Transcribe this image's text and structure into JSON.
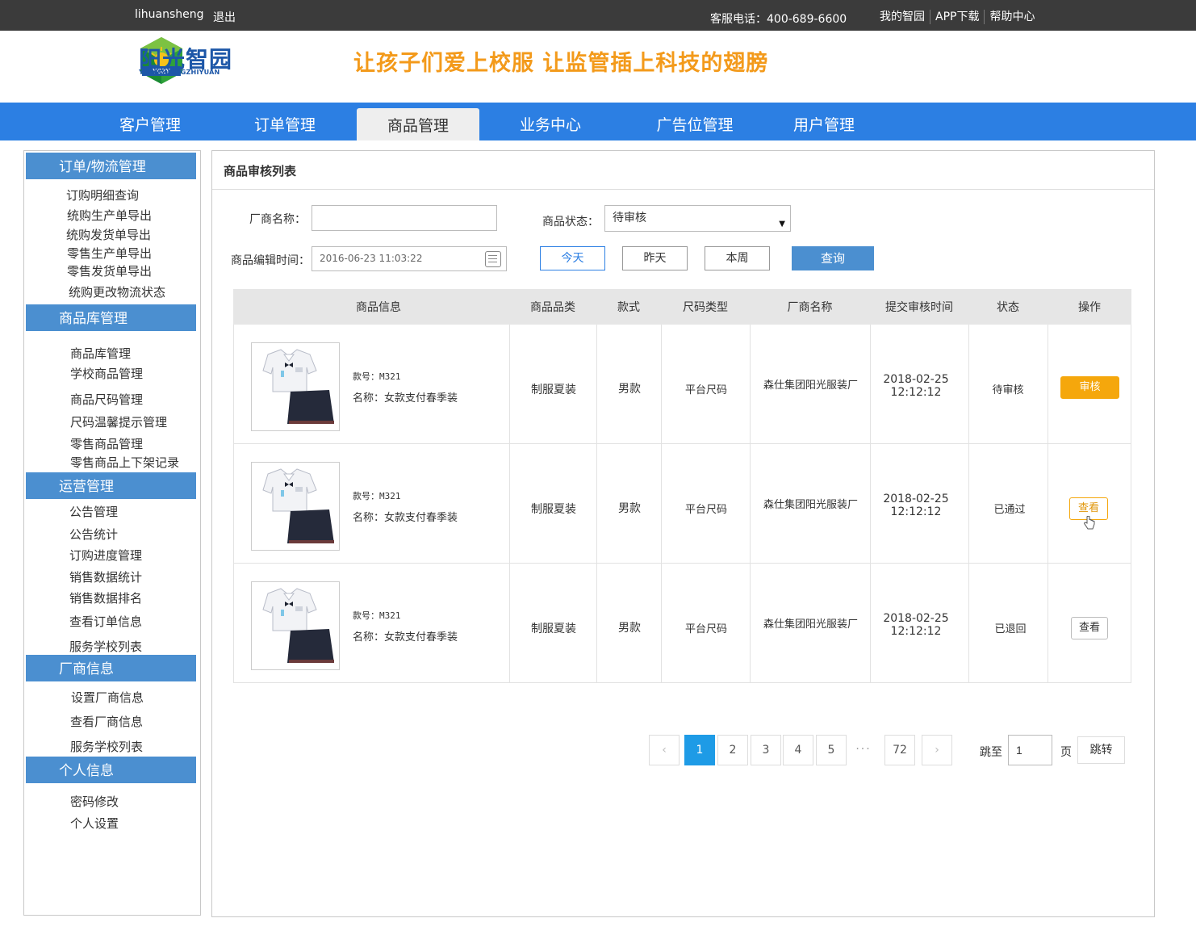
{
  "topbar": {
    "username": "lihuansheng",
    "logout": "退出",
    "hotline": "客服电话：400-689-6600",
    "links": [
      "我的智园",
      "APP下载",
      "帮助中心"
    ]
  },
  "header": {
    "logo_text": "阳光智园",
    "logo_sub": "YANGGUANGZHIYUAN",
    "logo_badge": "YGZY",
    "slogan": "让孩子们爱上校服  让监管插上科技的翅膀"
  },
  "nav": {
    "items": [
      "客户管理",
      "订单管理",
      "商品管理",
      "业务中心",
      "广告位管理",
      "用户管理"
    ],
    "active_index": 2
  },
  "sidebar": {
    "sections": [
      {
        "title": "订单/物流管理",
        "links": [
          "订购明细查询",
          "统购生产单导出",
          "统购发货单导出",
          "零售生产单导出",
          "零售发货单导出",
          "统购更改物流状态"
        ]
      },
      {
        "title": "商品库管理",
        "links": [
          "商品库管理",
          "学校商品管理",
          "商品尺码管理",
          "尺码温馨提示管理",
          "零售商品管理",
          "零售商品上下架记录"
        ]
      },
      {
        "title": "运营管理",
        "links": [
          "公告管理",
          "公告统计",
          "订购进度管理",
          "销售数据统计",
          "销售数据排名",
          "查看订单信息",
          "服务学校列表"
        ]
      },
      {
        "title": "厂商信息",
        "links": [
          "设置厂商信息",
          "查看厂商信息",
          "服务学校列表"
        ]
      },
      {
        "title": "个人信息",
        "links": [
          "密码修改",
          "个人设置"
        ]
      }
    ]
  },
  "main": {
    "title": "商品审核列表",
    "filters": {
      "vendor_label": "厂商名称：",
      "vendor_value": "",
      "status_label": "商品状态：",
      "status_value": "待审核",
      "time_label": "商品编辑时间：",
      "time_value": "2016-06-23 11:03:22",
      "btn_today": "今天",
      "btn_yesterday": "昨天",
      "btn_week": "本周",
      "btn_query": "查询"
    },
    "table": {
      "headers": [
        "商品信息",
        "商品品类",
        "款式",
        "尺码类型",
        "厂商名称",
        "提交审核时间",
        "状态",
        "操作"
      ],
      "rows": [
        {
          "code": "款号：M321",
          "name": "名称：女款支付春季装",
          "category": "制服夏装",
          "style": "男款",
          "size_type": "平台尺码",
          "vendor": "森仕集团阳光服装厂",
          "date": "2018-02-25",
          "time": "12:12:12",
          "status": "待审核",
          "action": "审核"
        },
        {
          "code": "款号：M321",
          "name": "名称：女款支付春季装",
          "category": "制服夏装",
          "style": "男款",
          "size_type": "平台尺码",
          "vendor": "森仕集团阳光服装厂",
          "date": "2018-02-25",
          "time": "12:12:12",
          "status": "已通过",
          "action": "查看"
        },
        {
          "code": "款号：M321",
          "name": "名称：女款支付春季装",
          "category": "制服夏装",
          "style": "男款",
          "size_type": "平台尺码",
          "vendor": "森仕集团阳光服装厂",
          "date": "2018-02-25",
          "time": "12:12:12",
          "status": "已退回",
          "action": "查看"
        }
      ]
    },
    "pagination": {
      "prev": "‹",
      "pages": [
        "1",
        "2",
        "3",
        "4",
        "5"
      ],
      "dots": "···",
      "last": "72",
      "next": "›",
      "current": "1",
      "jump_label": "跳至",
      "jump_value": "1",
      "page_unit": "页",
      "jump_button": "跳转"
    }
  }
}
